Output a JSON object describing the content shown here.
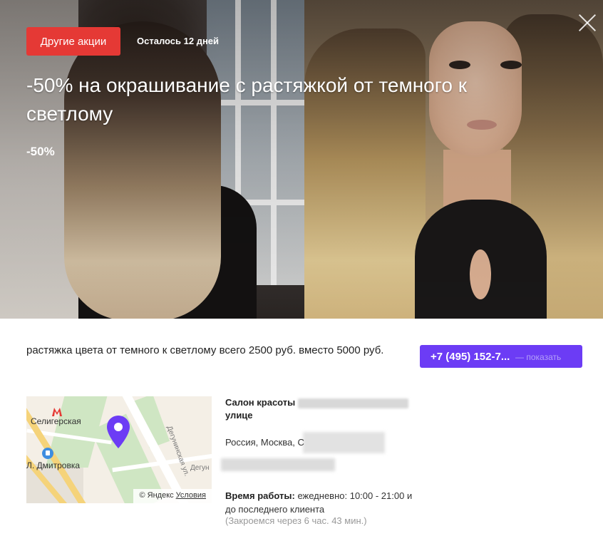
{
  "promo": {
    "other_offers_label": "Другие акции",
    "days_left": "Осталось 12 дней",
    "headline": "-50% на окрашивание с растяжкой от темного к светлому",
    "discount": "-50%"
  },
  "offer": {
    "description": "растяжка цвета от темного к светлому всего 2500 руб. вместо 5000 руб."
  },
  "phone": {
    "number": "+7 (495) 152-7...",
    "show_label": "— показать",
    "button_color": "#6c3cf5"
  },
  "map": {
    "station_label": "Селигерская",
    "poi_label": "Л. Дмитровка",
    "street_label_1": "Дегунинская ул.",
    "street_label_2": "Дегун",
    "credit": "© Яндекс",
    "terms_link": "Условия",
    "pin_color": "#6c3cf5",
    "icons": [
      "metro-icon",
      "shopping-bag-icon",
      "location-pin-icon"
    ]
  },
  "salon": {
    "name_prefix": "Салон красоты",
    "name_suffix": "улице",
    "address": "Россия, Москва, С"
  },
  "hours": {
    "label": "Время работы:",
    "value": "ежедневно: 10:00 - 21:00 и до последнего клиента",
    "closes_in": "(Закроемся через 6 час. 43 мин.)"
  },
  "colors": {
    "promo_button": "#e53935"
  }
}
